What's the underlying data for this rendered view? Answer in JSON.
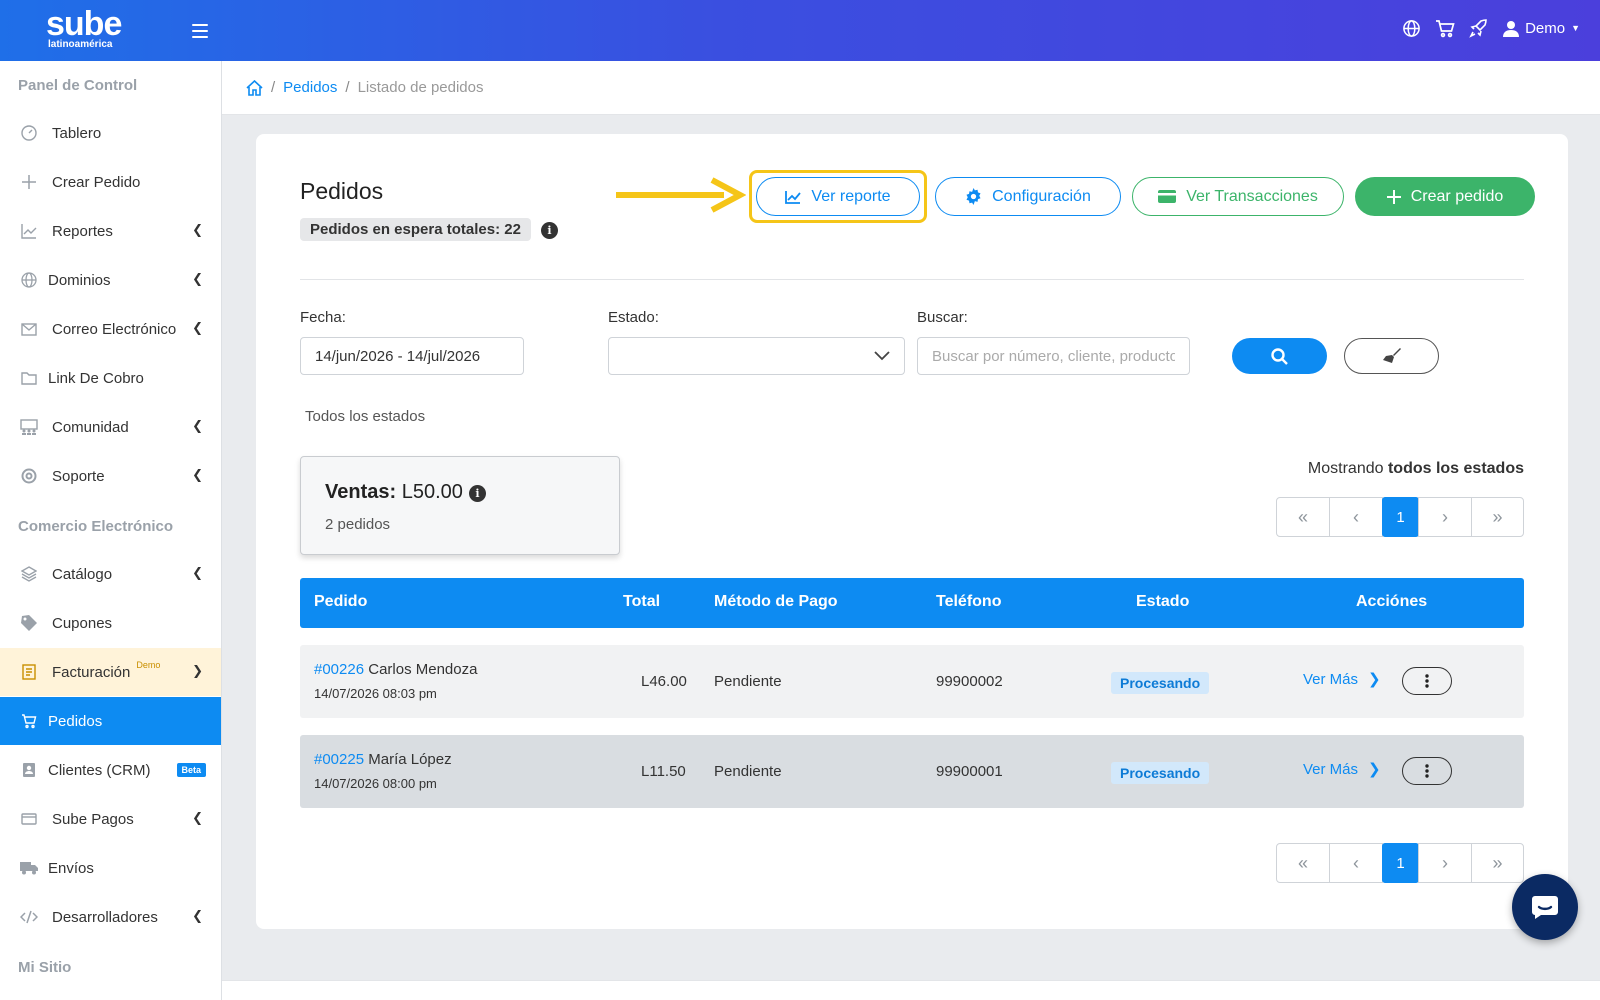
{
  "brand": {
    "name": "sube",
    "tagline": "latinoamérica"
  },
  "topbar": {
    "user_label": "Demo",
    "icons": [
      "globe-icon",
      "cart-icon",
      "rocket-icon",
      "user-icon"
    ]
  },
  "sidebar": {
    "section1": "Panel de Control",
    "section2": "Comercio Electrónico",
    "section3": "Mi Sitio",
    "items": [
      {
        "label": "Tablero",
        "icon": "gauge-icon"
      },
      {
        "label": "Crear Pedido",
        "icon": "plus-icon"
      },
      {
        "label": "Reportes",
        "icon": "chart-icon"
      },
      {
        "label": "Dominios",
        "icon": "globe-icon"
      },
      {
        "label": "Correo Electrónico",
        "icon": "mail-icon"
      },
      {
        "label": "Link De Cobro",
        "icon": "folder-icon"
      },
      {
        "label": "Comunidad",
        "icon": "community-icon"
      },
      {
        "label": "Soporte",
        "icon": "lifebuoy-icon"
      },
      {
        "label": "Catálogo",
        "icon": "layers-icon"
      },
      {
        "label": "Cupones",
        "icon": "tag-icon"
      },
      {
        "label": "Facturación",
        "icon": "invoice-icon",
        "sup": "Demo"
      },
      {
        "label": "Pedidos",
        "icon": "cart-icon"
      },
      {
        "label": "Clientes (CRM)",
        "icon": "contact-icon",
        "badge": "Beta"
      },
      {
        "label": "Sube Pagos",
        "icon": "card-icon"
      },
      {
        "label": "Envíos",
        "icon": "truck-icon"
      },
      {
        "label": "Desarrolladores",
        "icon": "code-icon"
      }
    ]
  },
  "breadcrumb": {
    "link": "Pedidos",
    "current": "Listado de pedidos"
  },
  "page": {
    "title": "Pedidos",
    "waiting_badge": "Pedidos en espera totales: 22",
    "buttons": {
      "report": "Ver reporte",
      "config": "Configuración",
      "transactions": "Ver Transacciones",
      "create": "Crear pedido"
    }
  },
  "filters": {
    "date_label": "Fecha:",
    "date_value": "14/jun/2026 - 14/jul/2026",
    "state_label": "Estado:",
    "search_label": "Buscar:",
    "search_placeholder": "Buscar por número, cliente, producto, t",
    "all_states": "Todos los estados"
  },
  "summary": {
    "sales_label": "Ventas:",
    "sales_value": "L50.00",
    "orders_count": "2 pedidos",
    "showing_prefix": "Mostrando",
    "showing_value": "todos los estados"
  },
  "pagination": {
    "current_page": "1"
  },
  "table": {
    "headers": [
      "Pedido",
      "Total",
      "Método de Pago",
      "Teléfono",
      "Estado",
      "Acciónes"
    ],
    "rows": [
      {
        "number": "#00226",
        "customer": "Carlos Mendoza",
        "date": "14/07/2026 08:03 pm",
        "total": "L46.00",
        "payment": "Pendiente",
        "phone": "99900002",
        "status": "Procesando",
        "action": "Ver Más"
      },
      {
        "number": "#00225",
        "customer": "María López",
        "date": "14/07/2026 08:00 pm",
        "total": "L11.50",
        "payment": "Pendiente",
        "phone": "99900001",
        "status": "Procesando",
        "action": "Ver Más"
      }
    ]
  },
  "colors": {
    "primary": "#0d8bf2",
    "success": "#3cb46a",
    "highlight": "#f5c518",
    "topbar_start": "#1f6fe8",
    "topbar_end": "#4b3fdc"
  }
}
